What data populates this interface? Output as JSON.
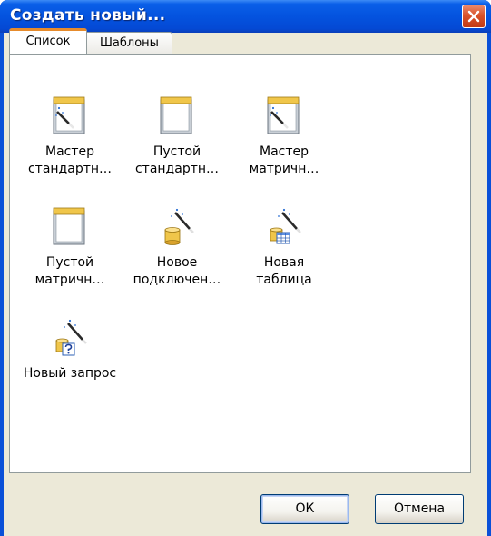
{
  "window": {
    "title": "Создать новый...",
    "close_icon": "close-icon"
  },
  "tabs": [
    {
      "label": "Список",
      "active": true
    },
    {
      "label": "Шаблоны",
      "active": false
    }
  ],
  "items": [
    {
      "label": "Мастер\nстандартн…",
      "icon": "wizard-report-icon"
    },
    {
      "label": "Пустой\nстандартн…",
      "icon": "blank-report-icon"
    },
    {
      "label": "Мастер\nматричн…",
      "icon": "wizard-report-icon"
    },
    {
      "label": "Пустой\nматричн…",
      "icon": "blank-report-icon"
    },
    {
      "label": "Новое\nподключен…",
      "icon": "new-connection-icon"
    },
    {
      "label": "Новая\nтаблица",
      "icon": "new-table-icon"
    },
    {
      "label": "Новый запрос",
      "icon": "new-query-icon"
    }
  ],
  "buttons": {
    "ok": "ОК",
    "cancel": "Отмена"
  },
  "colors": {
    "titlebar": "#0453df",
    "tab_highlight": "#e68b2c",
    "close": "#d9522a"
  }
}
